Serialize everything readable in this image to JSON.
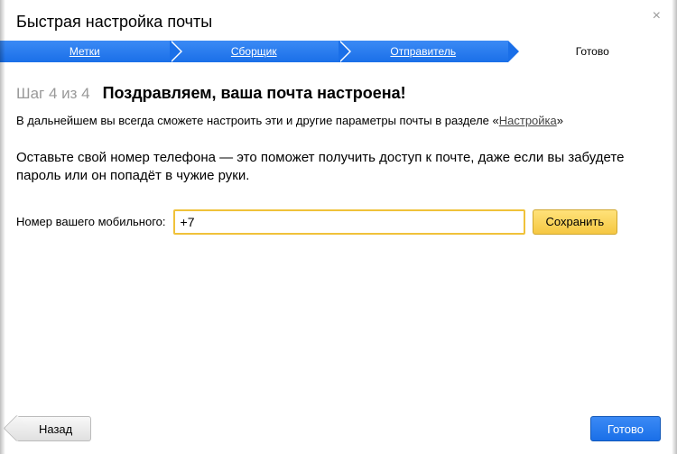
{
  "header": {
    "title": "Быстрая настройка почты",
    "close_symbol": "×"
  },
  "steps": [
    {
      "label": "Метки"
    },
    {
      "label": "Сборщик"
    },
    {
      "label": "Отправитель"
    },
    {
      "label": "Готово"
    }
  ],
  "main": {
    "step_indicator": "Шаг 4 из 4",
    "heading": "Поздравляем, ваша почта настроена!",
    "subtext_before": "В дальнейшем вы всегда сможете настроить эти и другие параметры почты в разделе «",
    "subtext_link": "Настройка",
    "subtext_after": "»",
    "info": "Оставьте свой номер телефона — это поможет получить доступ к почте, даже если вы забудете пароль или он попадёт в чужие руки.",
    "phone_label": "Номер вашего мобильного:",
    "phone_value": "+7",
    "save_label": "Сохранить"
  },
  "footer": {
    "back_label": "Назад",
    "done_label": "Готово"
  }
}
